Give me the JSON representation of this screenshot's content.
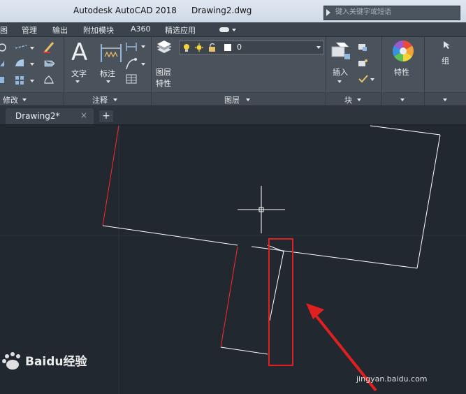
{
  "window": {
    "app_title": "Autodesk AutoCAD 2018",
    "file_title": "Drawing2.dwg"
  },
  "search": {
    "placeholder": "键入关键字或短语"
  },
  "ribbon_tabs": [
    "图",
    "管理",
    "输出",
    "附加模块",
    "A360",
    "精选应用"
  ],
  "panels": {
    "modify": {
      "label": "修改"
    },
    "annotation": {
      "label": "注释",
      "text_label": "文字",
      "dim_label": "标注"
    },
    "layers": {
      "label": "图层",
      "layer_props_label_1": "图层",
      "layer_props_label_2": "特性",
      "current_layer": "0"
    },
    "block": {
      "label": "块",
      "insert_label": "插入"
    },
    "properties": {
      "label": "特性"
    },
    "groups": {
      "label": "组"
    }
  },
  "doc_tabs": {
    "active": "Drawing2*",
    "close": "×",
    "new": "+"
  },
  "watermark": {
    "brand": "Baidu经验",
    "url": "jingyan.baidu.com"
  },
  "colors": {
    "canvas_bg": "#212830",
    "drawn_line": "#ffffff",
    "red_line": "#ff2a2a",
    "highlight": "#e02020",
    "annotation_arrow": "#e02020"
  },
  "icons": [
    "bulb-icon",
    "sun-icon",
    "unlock-icon",
    "color-swatch-icon",
    "text-icon",
    "dimension-icon",
    "insert-block-icon",
    "color-wheel-icon",
    "crosshair-cursor"
  ]
}
